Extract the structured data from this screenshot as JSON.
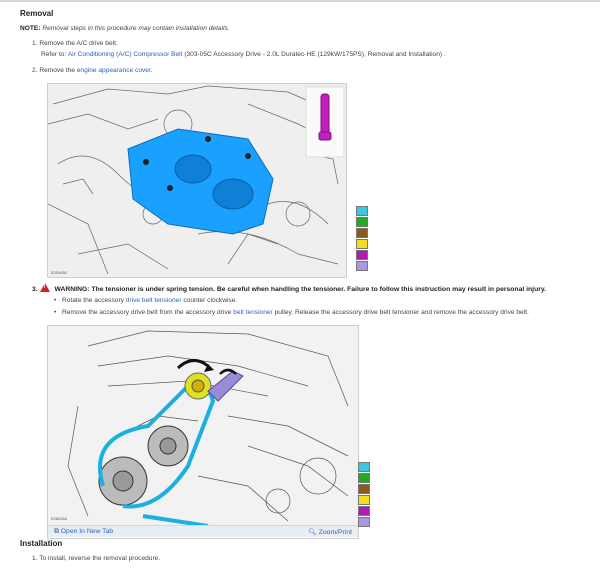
{
  "removal": {
    "heading": "Removal",
    "note_label": "NOTE:",
    "note_text": "Removal steps in this procedure may contain installation details.",
    "step1": {
      "label": "1. Remove the A/C drive belt.",
      "refer_prefix": "Refer to:",
      "refer_link": "Air Conditioning (A/C) Compressor Belt",
      "refer_suffix": "(303-05C Accessory Drive - 2.0L Duratec-HE (129kW/175PS), Removal and Installation) ."
    },
    "step2": {
      "prefix": "2. Remove the",
      "link": "engine appearance cover",
      "suffix": "."
    },
    "figure1": {
      "id": "E251652"
    },
    "step3": {
      "number": "3.",
      "warning_icon": "warning-triangle-icon",
      "warning": "WARNING: The tensioner is under spring tension. Be careful when handling the tensioner. Failure to follow this instruction may result in personal injury.",
      "bullet1_prefix": "Rotate the accessory",
      "bullet1_link": "drive belt tensioner",
      "bullet1_suffix": "counter clockwise.",
      "bullet2_prefix": "Remove the accessory drive belt from the accessory drive",
      "bullet2_link": "belt tensioner",
      "bullet2_suffix": "pulley. Release the accessory drive belt tensioner and remove the accessory drive belt."
    },
    "figure2": {
      "id": "E260284",
      "open_tab": "Open In New Tab",
      "zoom": "Zoom/Print"
    },
    "swatch_colors": [
      "#3cc8e0",
      "#22aa22",
      "#8a5a1e",
      "#f0e020",
      "#b01ab0",
      "#a89ae0"
    ]
  },
  "installation": {
    "heading": "Installation",
    "step1": "1. To install, reverse the removal procedure."
  }
}
